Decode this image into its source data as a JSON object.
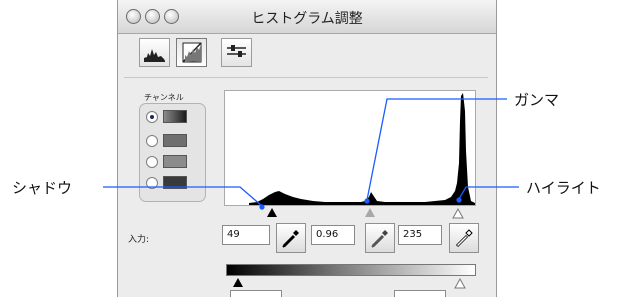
{
  "window": {
    "title": "ヒストグラム調整"
  },
  "toolbar": {
    "buttons": [
      {
        "icon": "histogram-icon"
      },
      {
        "icon": "curve-icon"
      },
      {
        "icon": "sliders-icon"
      }
    ]
  },
  "channel": {
    "label": "チャンネル",
    "options": [
      {
        "selected": true,
        "swatch": "composite"
      },
      {
        "selected": false,
        "swatch": "red"
      },
      {
        "selected": false,
        "swatch": "green"
      },
      {
        "selected": false,
        "swatch": "blue"
      }
    ]
  },
  "input": {
    "label": "入力:",
    "shadow_value": "49",
    "gamma_value": "0.96",
    "highlight_value": "235"
  },
  "callouts": {
    "shadow": "シャドウ",
    "gamma": "ガンマ",
    "highlight": "ハイライト"
  },
  "colors": {
    "callout_line": "#1a5cff",
    "slider_shadow": "#000000",
    "slider_gamma": "#a8a8a8",
    "slider_highlight": "#ffffff"
  }
}
